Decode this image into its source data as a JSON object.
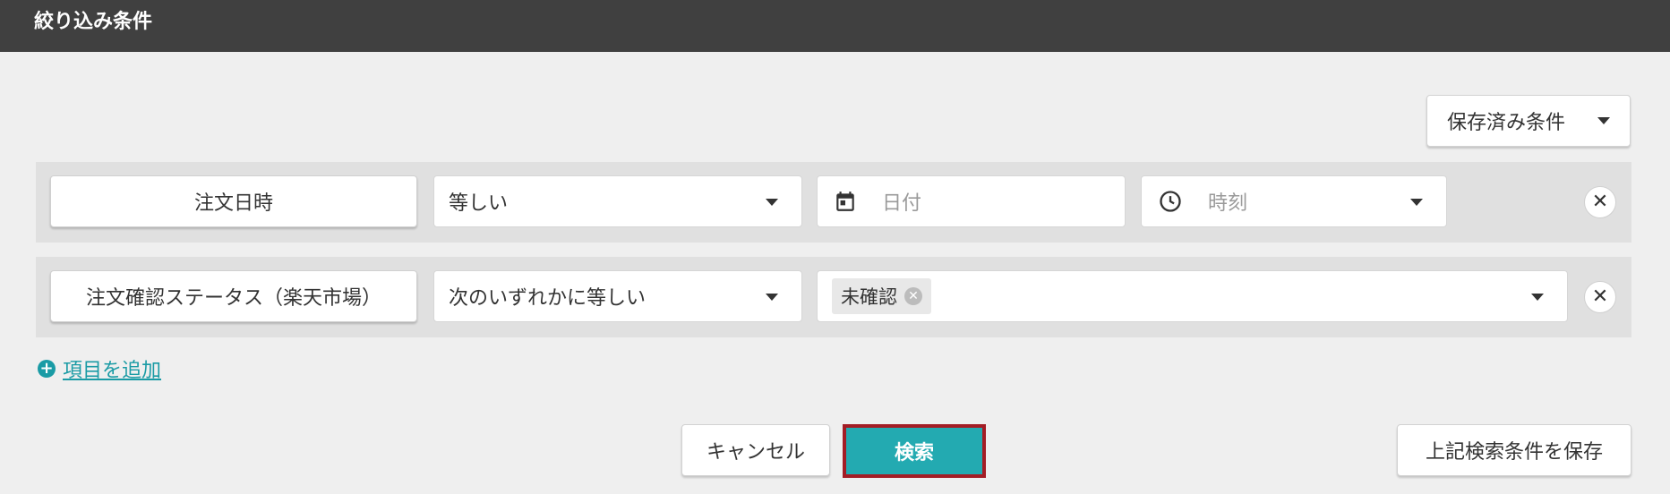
{
  "header": {
    "title": "絞り込み条件"
  },
  "saved_conditions": {
    "label": "保存済み条件"
  },
  "conditions": [
    {
      "field": "注文日時",
      "operator": "等しい",
      "date_placeholder": "日付",
      "time_placeholder": "時刻"
    },
    {
      "field": "注文確認ステータス（楽天市場）",
      "operator": "次のいずれかに等しい",
      "values": [
        "未確認"
      ]
    }
  ],
  "add_item": {
    "label": "項目を追加"
  },
  "footer": {
    "cancel_label": "キャンセル",
    "search_label": "検索",
    "save_label": "上記検索条件を保存"
  },
  "colors": {
    "header_bg": "#404040",
    "accent": "#23aab1",
    "link": "#1a9ba5",
    "highlight_border": "#a31d25"
  }
}
